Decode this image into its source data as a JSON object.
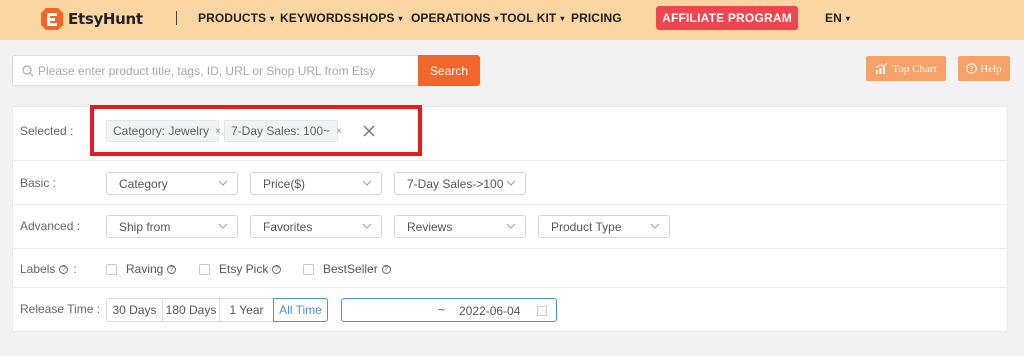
{
  "header": {
    "logo_text": "EtsyHunt",
    "nav": [
      {
        "label": "PRODUCTS",
        "has_caret": true
      },
      {
        "label": "KEYWORDS",
        "has_caret": false
      },
      {
        "label": "SHOPS",
        "has_caret": true
      },
      {
        "label": "OPERATIONS",
        "has_caret": true
      },
      {
        "label": "TOOL KIT",
        "has_caret": true
      },
      {
        "label": "PRICING",
        "has_caret": false
      }
    ],
    "affiliate_label": "AFFILIATE PROGRAM",
    "language": "EN",
    "caret_icon": "▾",
    "brand_color": "#f2662c",
    "header_bg": "#fbd6a3",
    "affiliate_color": "#f0444f"
  },
  "search": {
    "placeholder": "Please enter product title, tags, ID, URL or Shop URL from Etsy",
    "value": "",
    "button_label": "Search"
  },
  "top_actions": {
    "top_chart_label": "Top Chart",
    "help_label": "Help",
    "top_chart_icon": "chart-icon",
    "help_icon": "help-circle-icon"
  },
  "filters": {
    "selected": {
      "label": "Selected :",
      "tags": [
        {
          "text": "Category: Jewelry"
        },
        {
          "text": "7-Day Sales: 100~"
        }
      ],
      "tag_close_glyph": "×",
      "highlight_color": "#e41b23"
    },
    "basic": {
      "label": "Basic :",
      "selects": [
        "Category",
        "Price($)",
        "7-Day Sales->100"
      ]
    },
    "advanced": {
      "label": "Advanced :",
      "selects": [
        "Ship from",
        "Favorites",
        "Reviews",
        "Product Type"
      ]
    },
    "labels": {
      "label": "Labels",
      "label_suffix": ":",
      "help_glyph": "?",
      "options": [
        {
          "text": "Raving",
          "checked": false
        },
        {
          "text": "Etsy Pick",
          "checked": false
        },
        {
          "text": "BestSeller",
          "checked": false
        }
      ]
    },
    "release_time": {
      "label": "Release Time :",
      "options": [
        "30 Days",
        "180 Days",
        "1 Year",
        "All Time"
      ],
      "active": "All Time",
      "date_start": "",
      "date_separator": "~",
      "date_end": "2022-06-04",
      "active_color": "#4a90e2"
    }
  }
}
